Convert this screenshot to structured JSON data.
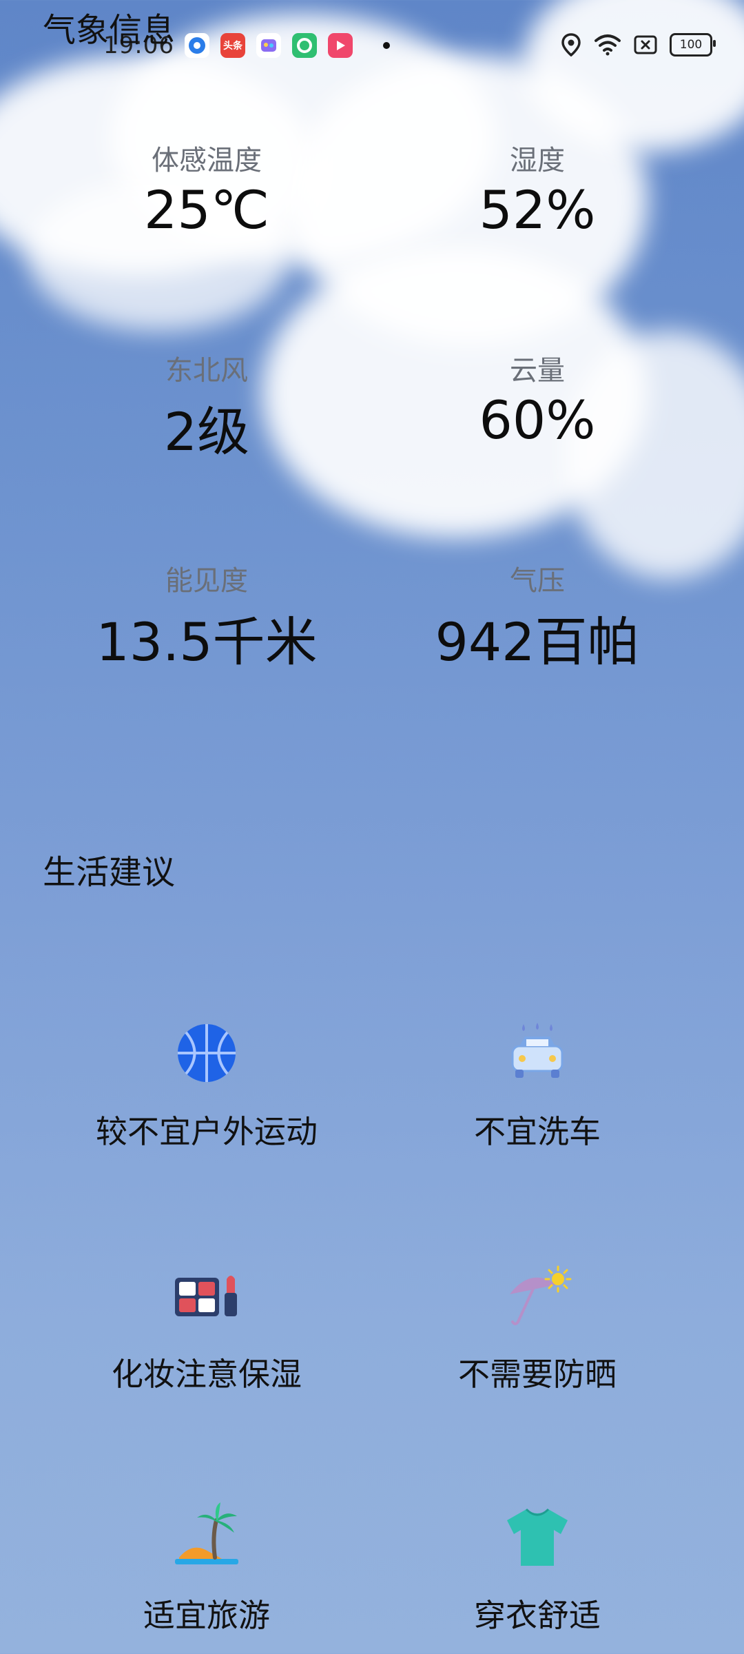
{
  "app": {
    "title": "气象信息"
  },
  "status_bar": {
    "time": "19:06",
    "apps": [
      {
        "name": "browser-app-icon",
        "label": "",
        "color": "#2b7de9"
      },
      {
        "name": "toutiao-app-icon",
        "label": "头条",
        "color": "#e8433a"
      },
      {
        "name": "taobao-app-icon",
        "label": "",
        "color": "#8a6cf2"
      },
      {
        "name": "green-app-icon",
        "label": "",
        "color": "#2fbf71"
      },
      {
        "name": "video-app-icon",
        "label": "",
        "color": "#f0476b"
      }
    ],
    "battery": "100"
  },
  "metrics": [
    {
      "label": "体感温度",
      "value": "25℃"
    },
    {
      "label": "湿度",
      "value": "52%"
    },
    {
      "label": "东北风",
      "value": "2级"
    },
    {
      "label": "云量",
      "value": "60%"
    },
    {
      "label": "能见度",
      "value": "13.5千米"
    },
    {
      "label": "气压",
      "value": "942百帕"
    }
  ],
  "life_tips": {
    "title": "生活建议",
    "items": [
      {
        "icon": "basketball-icon",
        "label": "较不宜户外运动"
      },
      {
        "icon": "car-wash-icon",
        "label": "不宜洗车"
      },
      {
        "icon": "makeup-icon",
        "label": "化妆注意保湿"
      },
      {
        "icon": "umbrella-sun-icon",
        "label": "不需要防晒"
      },
      {
        "icon": "island-palm-icon",
        "label": "适宜旅游"
      },
      {
        "icon": "tshirt-icon",
        "label": "穿衣舒适"
      }
    ]
  }
}
